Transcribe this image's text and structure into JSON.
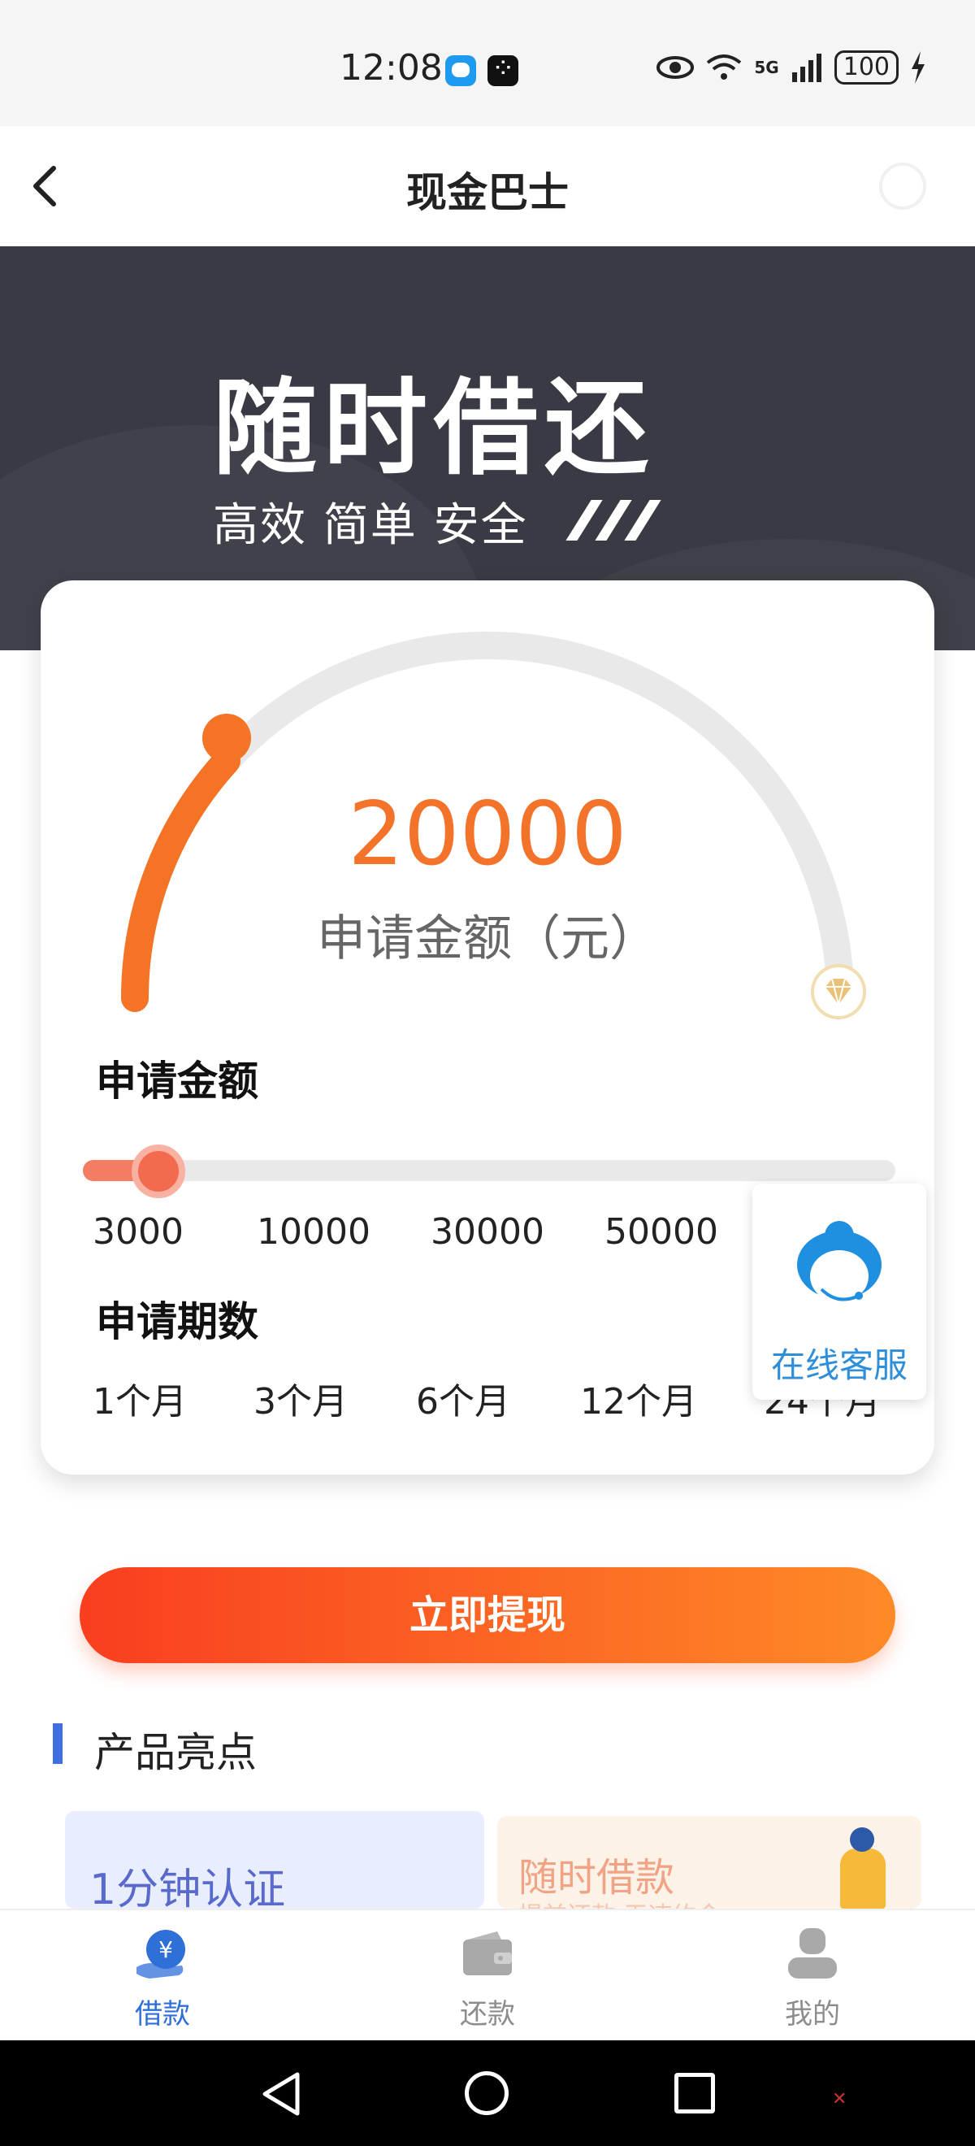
{
  "status_bar": {
    "time": "12:08",
    "network": "5G",
    "battery": "100"
  },
  "header": {
    "title": "现金巴士"
  },
  "banner": {
    "title": "随时借还",
    "subtitle": "高效 简单 安全"
  },
  "loan": {
    "amount_value": "20000",
    "amount_caption": "申请金额（元）",
    "amount_section_label": "申请金额",
    "slider_progress": 0.06,
    "amount_ticks": [
      "3000",
      "10000",
      "30000",
      "50000"
    ],
    "term_section_label": "申请期数",
    "term_options": [
      "1个月",
      "3个月",
      "6个月",
      "12个月",
      "24个月"
    ]
  },
  "customer_service": {
    "label": "在线客服"
  },
  "cta": {
    "label": "立即提现"
  },
  "highlights": {
    "title": "产品亮点",
    "cards": [
      {
        "title": "1分钟认证"
      },
      {
        "title": "随时借款",
        "subtitle": "提前还款 无违约金"
      }
    ]
  },
  "bottom_nav": {
    "items": [
      {
        "label": "借款",
        "icon": "loan-icon",
        "active": true
      },
      {
        "label": "还款",
        "icon": "wallet-icon",
        "active": false
      },
      {
        "label": "我的",
        "icon": "profile-icon",
        "active": false
      }
    ]
  },
  "colors": {
    "accent": "#f27329",
    "cta_start": "#f93e20",
    "cta_end": "#fe8a27",
    "nav_active": "#2f6fd8",
    "nav_inactive": "#8c8c8c",
    "banner_bg": "#3a3a44"
  }
}
